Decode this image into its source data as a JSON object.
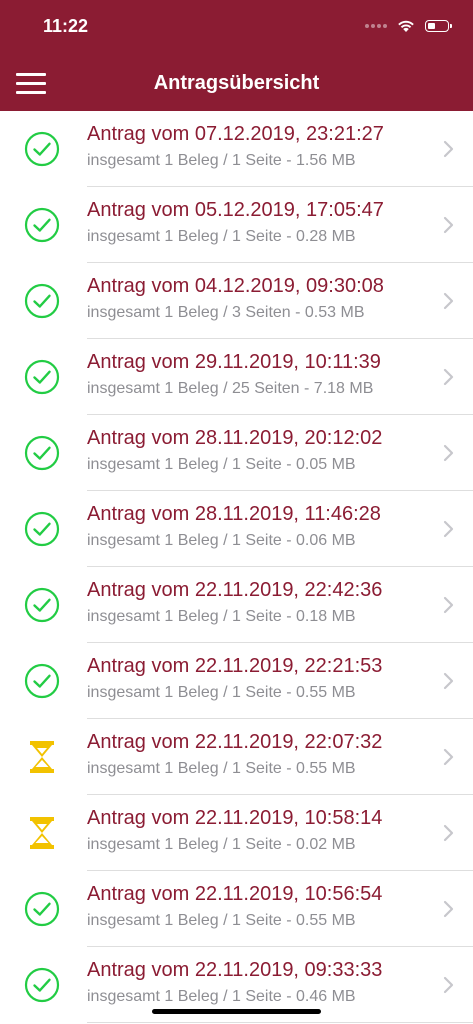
{
  "status_bar": {
    "time": "11:22"
  },
  "header": {
    "title": "Antragsübersicht",
    "menu_icon": "hamburger-menu-icon"
  },
  "colors": {
    "brand": "#8b1c33",
    "success": "#22cc44",
    "pending": "#f2c200",
    "subtitle": "#8e8e93"
  },
  "list": {
    "items": [
      {
        "title": "Antrag vom 07.12.2019, 23:21:27",
        "subtitle": "insgesamt 1 Beleg / 1 Seite - 1.56 MB",
        "status": "completed"
      },
      {
        "title": "Antrag vom 05.12.2019, 17:05:47",
        "subtitle": "insgesamt 1 Beleg / 1 Seite - 0.28 MB",
        "status": "completed"
      },
      {
        "title": "Antrag vom 04.12.2019, 09:30:08",
        "subtitle": "insgesamt 1 Beleg / 3 Seiten - 0.53 MB",
        "status": "completed"
      },
      {
        "title": "Antrag vom 29.11.2019, 10:11:39",
        "subtitle": "insgesamt 1 Beleg / 25 Seiten - 7.18 MB",
        "status": "completed"
      },
      {
        "title": "Antrag vom 28.11.2019, 20:12:02",
        "subtitle": "insgesamt 1 Beleg / 1 Seite - 0.05 MB",
        "status": "completed"
      },
      {
        "title": "Antrag vom 28.11.2019, 11:46:28",
        "subtitle": "insgesamt 1 Beleg / 1 Seite - 0.06 MB",
        "status": "completed"
      },
      {
        "title": "Antrag vom 22.11.2019, 22:42:36",
        "subtitle": "insgesamt 1 Beleg / 1 Seite - 0.18 MB",
        "status": "completed"
      },
      {
        "title": "Antrag vom 22.11.2019, 22:21:53",
        "subtitle": "insgesamt 1 Beleg / 1 Seite - 0.55 MB",
        "status": "completed"
      },
      {
        "title": "Antrag vom 22.11.2019, 22:07:32",
        "subtitle": "insgesamt 1 Beleg / 1 Seite - 0.55 MB",
        "status": "pending"
      },
      {
        "title": "Antrag vom 22.11.2019, 10:58:14",
        "subtitle": "insgesamt 1 Beleg / 1 Seite - 0.02 MB",
        "status": "pending"
      },
      {
        "title": "Antrag vom 22.11.2019, 10:56:54",
        "subtitle": "insgesamt 1 Beleg / 1 Seite - 0.55 MB",
        "status": "completed"
      },
      {
        "title": "Antrag vom 22.11.2019, 09:33:33",
        "subtitle": "insgesamt 1 Beleg / 1 Seite - 0.46 MB",
        "status": "completed"
      }
    ]
  }
}
